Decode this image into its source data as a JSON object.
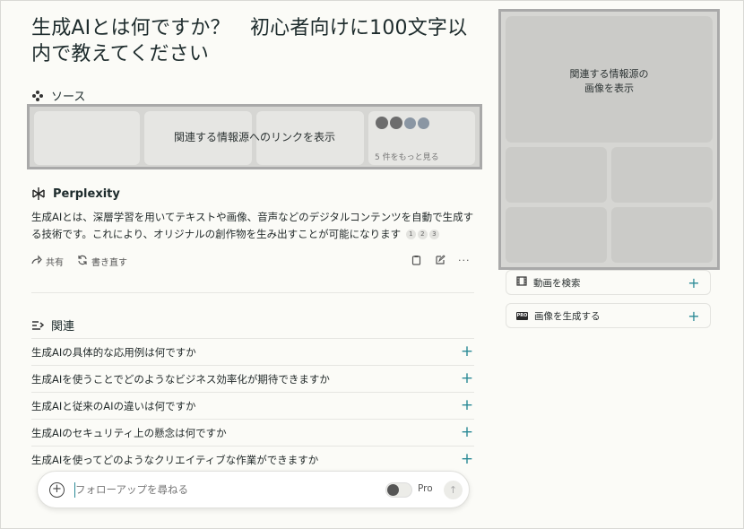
{
  "title": "生成AIとは何ですか？　初心者向けに100文字以内で教えてください",
  "sources": {
    "heading": "ソース",
    "overlay_text": "関連する情報源へのリンクを表示",
    "more_label": "5 件をもっと見る"
  },
  "answer": {
    "heading": "Perplexity",
    "text": "生成AIとは、深層学習を用いてテキストや画像、音声などのデジタルコンテンツを自動で生成する技術です。これにより、オリジナルの創作物を生み出すことが可能になります",
    "citations": [
      "1",
      "2",
      "3"
    ]
  },
  "actions": {
    "share_label": "共有",
    "rewrite_label": "書き直す"
  },
  "related": {
    "heading": "関連",
    "items": [
      "生成AIの具体的な応用例は何ですか",
      "生成AIを使うことでどのようなビジネス効率化が期待できますか",
      "生成AIと従来のAIの違いは何ですか",
      "生成AIのセキュリティ上の懸念は何ですか",
      "生成AIを使ってどのようなクリエイティブな作業ができますか"
    ]
  },
  "followup": {
    "placeholder": "フォローアップを尋ねる",
    "pro_label": "Pro"
  },
  "media": {
    "overlay_line1": "関連する情報源の",
    "overlay_line2": "画像を表示",
    "search_video_label": "動画を検索",
    "generate_image_label": "画像を生成する",
    "pro_badge": "PRO"
  },
  "colors": {
    "accent": "#2b8a96",
    "background": "#fbfbf7",
    "placeholder_gray": "#d6d6d3",
    "highlight_border": "#a9a9a9"
  }
}
